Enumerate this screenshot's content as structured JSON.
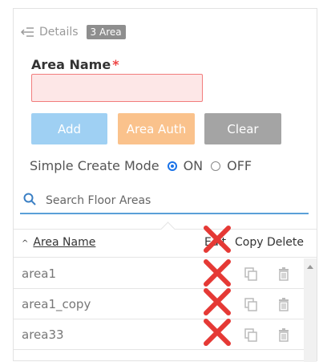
{
  "details": {
    "title": "Details",
    "badge": "3 Area"
  },
  "form": {
    "area_name_label": "Area Name",
    "required_mark": "*",
    "area_name_value": ""
  },
  "buttons": {
    "add": "Add",
    "area_auth": "Area Auth",
    "clear": "Clear"
  },
  "mode": {
    "label": "Simple Create Mode",
    "on": "ON",
    "off": "OFF",
    "selected": "ON"
  },
  "search": {
    "placeholder": "Search Floor Areas"
  },
  "table": {
    "columns": {
      "name": "Area Name",
      "edit": "Edit",
      "copy": "Copy",
      "delete": "Delete"
    },
    "sort_direction": "ascending",
    "rows": [
      {
        "name": "area1"
      },
      {
        "name": "area1_copy"
      },
      {
        "name": "area33"
      }
    ]
  },
  "colors": {
    "add_button": "#9fd0f3",
    "area_auth_button": "#fac28c",
    "clear_button": "#a4a4a4",
    "invalid_field_bg": "#fde7e7",
    "invalid_field_border": "#f27d7d",
    "accent": "#1a73e8",
    "x_mark": "#e53935"
  },
  "icons": {
    "back": "back-arrow-icon",
    "search": "search-icon",
    "edit_disabled": "x-mark-icon",
    "copy": "copy-icon",
    "delete": "trash-icon"
  }
}
